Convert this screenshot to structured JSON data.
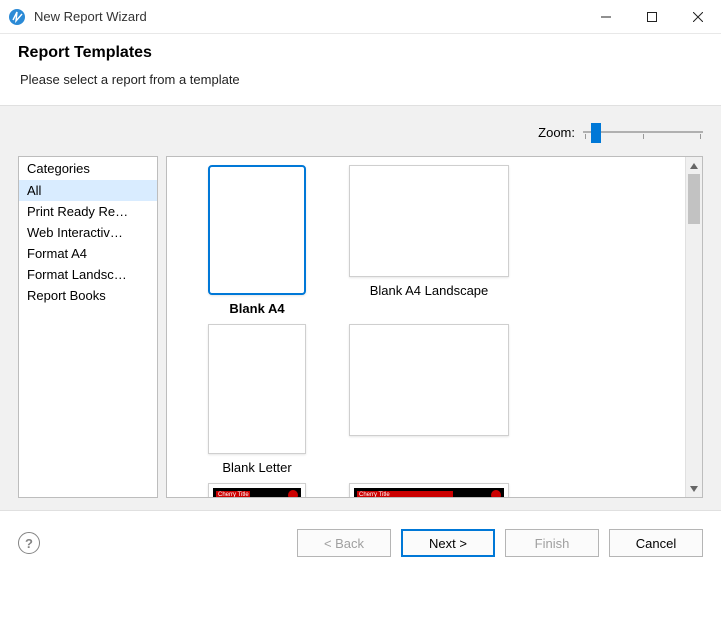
{
  "window": {
    "title": "New Report Wizard"
  },
  "header": {
    "heading": "Report Templates",
    "subtitle": "Please select a report from a template"
  },
  "zoom": {
    "label": "Zoom:"
  },
  "sidebar": {
    "header": "Categories",
    "items": [
      {
        "label": "All",
        "selected": true
      },
      {
        "label": "Print Ready Re…",
        "selected": false
      },
      {
        "label": "Web Interactiv…",
        "selected": false
      },
      {
        "label": "Format A4",
        "selected": false
      },
      {
        "label": "Format Landsc…",
        "selected": false
      },
      {
        "label": "Report Books",
        "selected": false
      }
    ]
  },
  "templates": [
    {
      "label": "Blank A4",
      "orientation": "portrait",
      "style": "blank",
      "selected": true
    },
    {
      "label": "Blank A4 Landscape",
      "orientation": "landscape",
      "style": "blank",
      "selected": false
    },
    {
      "label": "Blank Letter",
      "orientation": "portrait",
      "style": "blank",
      "selected": false
    },
    {
      "label": "",
      "orientation": "landscape",
      "style": "blank",
      "selected": false
    },
    {
      "label": "",
      "orientation": "portrait",
      "style": "cherry",
      "preview_title": "Cherry Title",
      "selected": false
    },
    {
      "label": "",
      "orientation": "landscape",
      "style": "cherry",
      "preview_title": "Cherry Title",
      "selected": false
    }
  ],
  "buttons": {
    "back": "< Back",
    "next": "Next >",
    "finish": "Finish",
    "cancel": "Cancel"
  }
}
